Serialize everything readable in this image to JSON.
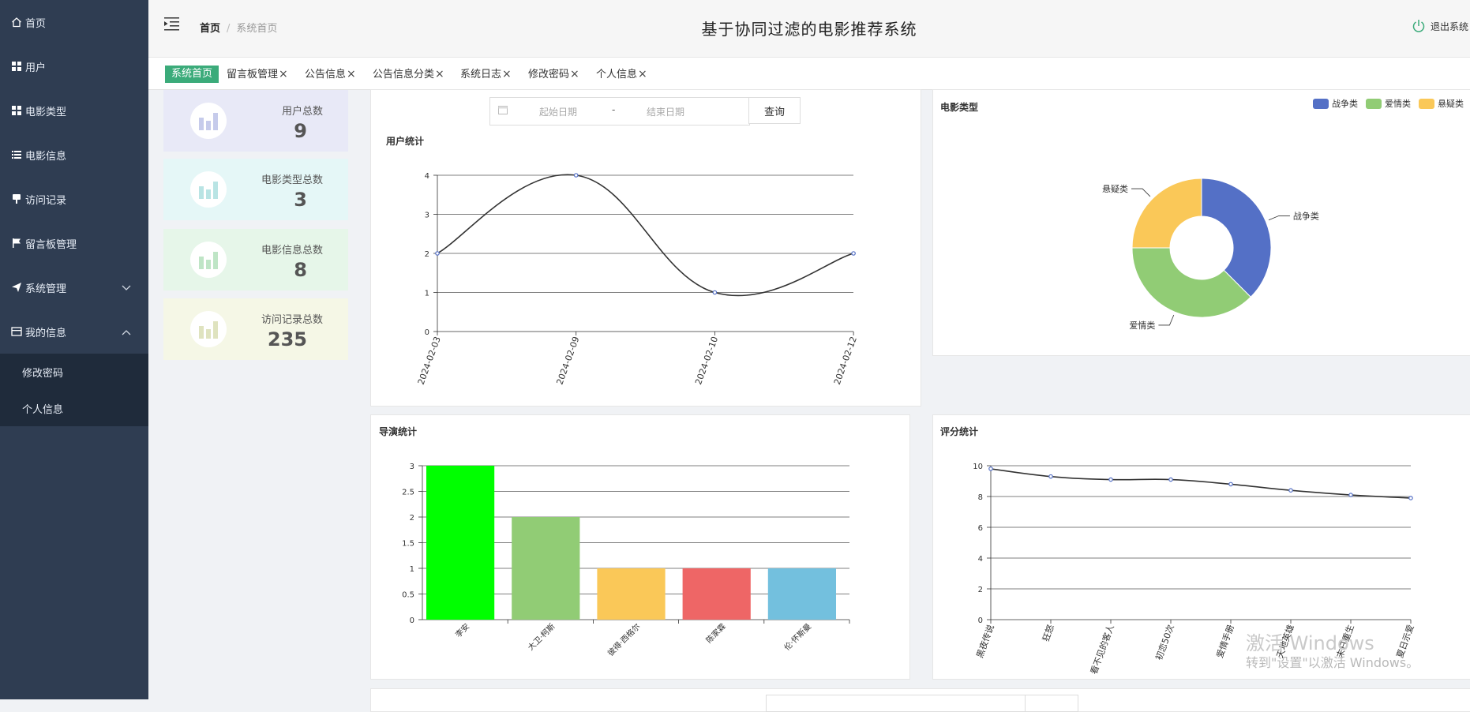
{
  "sidebar": {
    "items": [
      {
        "label": "首页",
        "icon": "home-icon"
      },
      {
        "label": "用户",
        "icon": "grid-icon"
      },
      {
        "label": "电影类型",
        "icon": "grid-icon"
      },
      {
        "label": "电影信息",
        "icon": "list-icon"
      },
      {
        "label": "访问记录",
        "icon": "pin-icon"
      },
      {
        "label": "留言板管理",
        "icon": "flag-icon"
      },
      {
        "label": "系统管理",
        "icon": "send-icon"
      },
      {
        "label": "我的信息",
        "icon": "card-icon"
      }
    ],
    "submenu": [
      "修改密码",
      "个人信息"
    ]
  },
  "header": {
    "breadcrumb_home": "首页",
    "breadcrumb_sep": "/",
    "breadcrumb_current": "系统首页",
    "title": "基于协同过滤的电影推荐系统",
    "logout": "退出系统"
  },
  "tabs": [
    {
      "label": "系统首页",
      "active": true
    },
    {
      "label": "留言板管理",
      "close": "×"
    },
    {
      "label": "公告信息",
      "close": "×"
    },
    {
      "label": "公告信息分类",
      "close": "×"
    },
    {
      "label": "系统日志",
      "close": "×"
    },
    {
      "label": "修改密码",
      "close": "×"
    },
    {
      "label": "个人信息",
      "close": "×"
    }
  ],
  "stats": [
    {
      "label": "用户总数",
      "value": "9",
      "bg": "#e8e9f7",
      "icon": "#c6cbeb"
    },
    {
      "label": "电影类型总数",
      "value": "3",
      "bg": "#e5f7f7",
      "icon": "#b9e4e4"
    },
    {
      "label": "电影信息总数",
      "value": "8",
      "bg": "#e6f6e9",
      "icon": "#bfe5c6"
    },
    {
      "label": "访问记录总数",
      "value": "235",
      "bg": "#f5f7e6",
      "icon": "#dfe3bf"
    }
  ],
  "date_filter": {
    "start_placeholder": "起始日期",
    "separator": "-",
    "end_placeholder": "结束日期",
    "query_label": "查询"
  },
  "colors": {
    "sidebar": "#2f3d52",
    "submenu": "#1f2b3b",
    "active_tab": "#3bab7a"
  },
  "chart_data": [
    {
      "id": "users",
      "type": "line",
      "title": "用户统计",
      "x": [
        "2024-02-03",
        "2024-02-09",
        "2024-02-10",
        "2024-02-12"
      ],
      "y": [
        2,
        4,
        1,
        2
      ],
      "yticks": [
        "0",
        "1",
        "2",
        "3",
        "4"
      ],
      "ylim": [
        0,
        4
      ]
    },
    {
      "id": "genres",
      "type": "pie",
      "title": "电影类型",
      "labels": [
        "战争类",
        "爱情类",
        "悬疑类"
      ],
      "values": [
        3,
        3,
        2
      ],
      "colors": [
        "#5470c6",
        "#91cc75",
        "#fac858"
      ],
      "legend": "top-right"
    },
    {
      "id": "directors",
      "type": "bar",
      "title": "导演统计",
      "categories": [
        "李安",
        "大卫·柯斯",
        "彼得·西格尔",
        "陈家霖",
        "伦·怀斯曼"
      ],
      "values": [
        3,
        2,
        1,
        1,
        1
      ],
      "colors": [
        "#00ff00",
        "#91cc75",
        "#fac858",
        "#ee6666",
        "#73c0de"
      ],
      "yticks": [
        "0",
        "0.5",
        "1",
        "1.5",
        "2",
        "2.5",
        "3"
      ],
      "ylim": [
        0,
        3
      ]
    },
    {
      "id": "ratings",
      "type": "line",
      "title": "评分统计",
      "x": [
        "黑夜传说",
        "狂怒",
        "看不见的客人",
        "初恋50次",
        "爱情手册",
        "天地英雄",
        "末日重生",
        "夏日示爱"
      ],
      "y": [
        9.8,
        9.3,
        9.1,
        9.1,
        8.8,
        8.4,
        8.1,
        7.9
      ],
      "yticks": [
        "0",
        "2",
        "4",
        "6",
        "8",
        "10"
      ],
      "ylim": [
        0,
        10
      ]
    }
  ],
  "watermark": {
    "line1": "激活 Windows",
    "line2": "转到\"设置\"以激活 Windows。"
  }
}
